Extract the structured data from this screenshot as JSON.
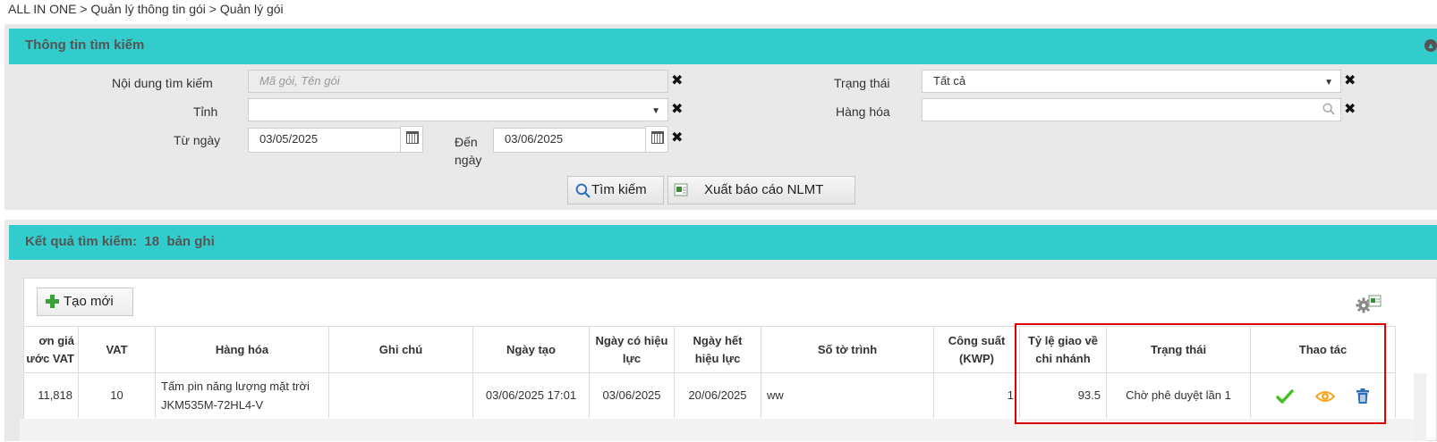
{
  "breadcrumb": "ALL IN ONE > Quản lý thông tin gói > Quản lý gói",
  "search": {
    "title": "Thông tin tìm kiếm",
    "content_label": "Nội dung tìm kiếm",
    "content_placeholder": "Mã gói, Tên gói",
    "province_label": "Tỉnh",
    "province_value": "",
    "from_label": "Từ ngày",
    "from_value": "03/05/2025",
    "to_label": "Đến ngày",
    "to_value": "03/06/2025",
    "status_label": "Trạng thái",
    "status_value": "Tất cả",
    "goods_label": "Hàng hóa",
    "goods_value": "",
    "search_button": "Tìm kiếm",
    "export_button": "Xuất báo cáo NLMT"
  },
  "results": {
    "title_prefix": "Kết quả tìm kiếm:",
    "count": "18",
    "count_suffix": "bản ghi",
    "create_button": "Tạo mới",
    "headers": {
      "price_line1": "ơn giá",
      "price_line2": "ước VAT",
      "vat": "VAT",
      "goods": "Hàng hóa",
      "note": "Ghi chú",
      "created": "Ngày tạo",
      "valid_from_line1": "Ngày có hiệu",
      "valid_from_line2": "lực",
      "valid_to_line1": "Ngày hết",
      "valid_to_line2": "hiệu lực",
      "doc_no": "Số tờ trình",
      "capacity_line1": "Công suất",
      "capacity_line2": "(KWP)",
      "ratio_line1": "Tỷ lệ giao về",
      "ratio_line2": "chi nhánh",
      "status": "Trạng thái",
      "actions": "Thao tác"
    },
    "rows": [
      {
        "price": "11,818",
        "vat": "10",
        "goods_line1": "Tấm pin năng lượng mặt trời",
        "goods_line2": "JKM535M-72HL4-V",
        "note": "",
        "created": "03/06/2025 17:01",
        "valid_from": "03/06/2025",
        "valid_to": "20/06/2025",
        "doc_no": "ww",
        "capacity": "1",
        "ratio": "93.5",
        "status": "Chờ phê duyệt lần 1"
      }
    ]
  },
  "icons": {
    "approve": "check-icon",
    "view": "eye-icon",
    "delete": "trash-icon"
  },
  "colors": {
    "header_bg": "#33cccc",
    "highlight": "#e00000",
    "approve": "#44c022",
    "view": "#f5a623",
    "delete": "#2f6fb7"
  }
}
